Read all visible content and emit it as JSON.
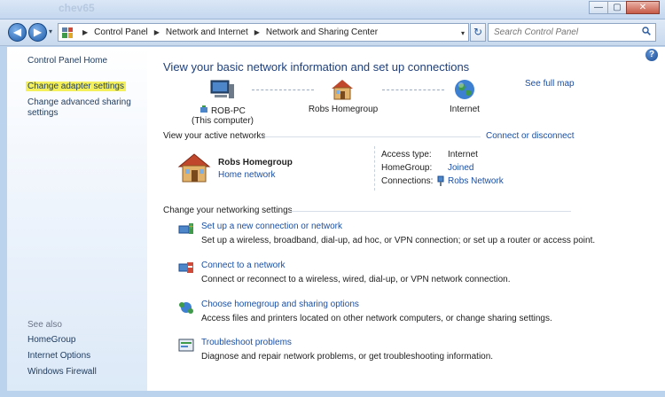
{
  "window": {
    "ghost_title": "chev65",
    "min_glyph": "—",
    "max_glyph": "▢",
    "close_glyph": "✕"
  },
  "nav": {
    "back_glyph": "◀",
    "forward_glyph": "▶",
    "dropdown_glyph": "▾",
    "separator_glyph": "▶",
    "breadcrumb": [
      "Control Panel",
      "Network and Internet",
      "Network and Sharing Center"
    ],
    "refresh_glyph": "↻",
    "search_placeholder": "Search Control Panel"
  },
  "sidebar": {
    "home": "Control Panel Home",
    "change_adapter": "Change adapter settings",
    "change_sharing_1": "Change advanced sharing",
    "change_sharing_2": "settings",
    "see_also": "See also",
    "see_also_items": [
      "HomeGroup",
      "Internet Options",
      "Windows Firewall"
    ],
    "highlight_color": "#f4f05b"
  },
  "main": {
    "help_glyph": "?",
    "title": "View your basic network information and set up connections",
    "see_full_map": "See full map",
    "map": {
      "pc_name": "ROB-PC",
      "pc_sub": "(This computer)",
      "homegroup": "Robs Homegroup",
      "internet": "Internet"
    },
    "active": {
      "section": "View your active networks",
      "connect_link": "Connect or disconnect",
      "network_name": "Robs Homegroup",
      "network_type": "Home network",
      "access_label": "Access type:",
      "access_value": "Internet",
      "homegroup_label": "HomeGroup:",
      "homegroup_value": "Joined",
      "connections_label": "Connections:",
      "connections_value": "Robs Network"
    },
    "settings": {
      "section": "Change your networking settings",
      "tasks": [
        {
          "title": "Set up a new connection or network",
          "desc": "Set up a wireless, broadband, dial-up, ad hoc, or VPN connection; or set up a router or access point."
        },
        {
          "title": "Connect to a network",
          "desc": "Connect or reconnect to a wireless, wired, dial-up, or VPN network connection."
        },
        {
          "title": "Choose homegroup and sharing options",
          "desc": "Access files and printers located on other network computers, or change sharing settings."
        },
        {
          "title": "Troubleshoot problems",
          "desc": "Diagnose and repair network problems, or get troubleshooting information."
        }
      ]
    }
  },
  "colors": {
    "link": "#1a4fa4",
    "title": "#1e3f7a",
    "frame": "#bcd3ee"
  }
}
